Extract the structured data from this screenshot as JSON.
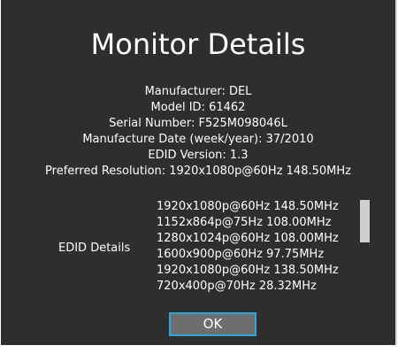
{
  "dialog": {
    "title": "Monitor Details"
  },
  "info": {
    "manufacturer": "Manufacturer: DEL",
    "model_id": "Model ID: 61462",
    "serial_number": "Serial Number: F525M098046L",
    "manufacture_date": "Manufacture Date (week/year): 37/2010",
    "edid_version": "EDID Version: 1.3",
    "preferred_resolution": "Preferred Resolution: 1920x1080p@60Hz 148.50MHz"
  },
  "edid": {
    "label": "EDID Details",
    "entries": [
      "1920x1080p@60Hz 148.50MHz",
      "1152x864p@75Hz 108.00MHz",
      "1280x1024p@60Hz 108.00MHz",
      "1600x900p@60Hz 97.75MHz",
      "1920x1080p@60Hz 138.50MHz",
      "720x400p@70Hz 28.32MHz"
    ]
  },
  "buttons": {
    "ok_label": "OK"
  },
  "colors": {
    "background": "#2e2e2e",
    "text": "#ffffff",
    "button_bg": "#6e6e6e",
    "button_border": "#29a6da",
    "scrollbar_thumb": "#cfcfcf"
  }
}
